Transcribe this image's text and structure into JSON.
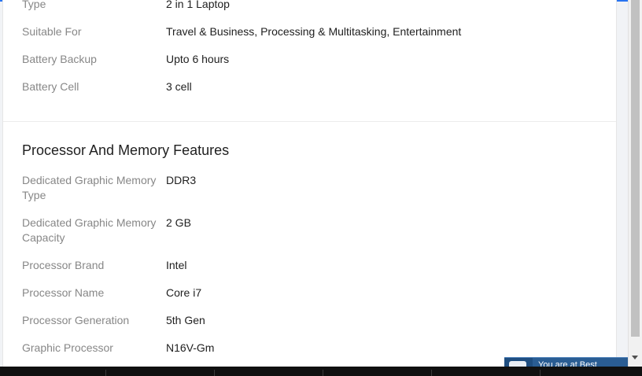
{
  "specs_top": [
    {
      "label": "Type",
      "value": "2 in 1 Laptop"
    },
    {
      "label": "Suitable For",
      "value": "Travel & Business, Processing & Multitasking, Entertainment"
    },
    {
      "label": "Battery Backup",
      "value": "Upto 6 hours"
    },
    {
      "label": "Battery Cell",
      "value": "3 cell"
    }
  ],
  "processor_section": {
    "title": "Processor And Memory Features",
    "specs": [
      {
        "label": "Dedicated Graphic Memory Type",
        "value": "DDR3"
      },
      {
        "label": "Dedicated Graphic Memory Capacity",
        "value": "2 GB"
      },
      {
        "label": "Processor Brand",
        "value": "Intel"
      },
      {
        "label": "Processor Name",
        "value": "Core i7"
      },
      {
        "label": "Processor Generation",
        "value": "5th Gen"
      },
      {
        "label": "Graphic Processor",
        "value": "N16V-Gm"
      }
    ]
  },
  "notification": {
    "text": "You are at Best"
  },
  "colors": {
    "accent": "#2874f0",
    "label": "#878787",
    "value": "#212121"
  }
}
